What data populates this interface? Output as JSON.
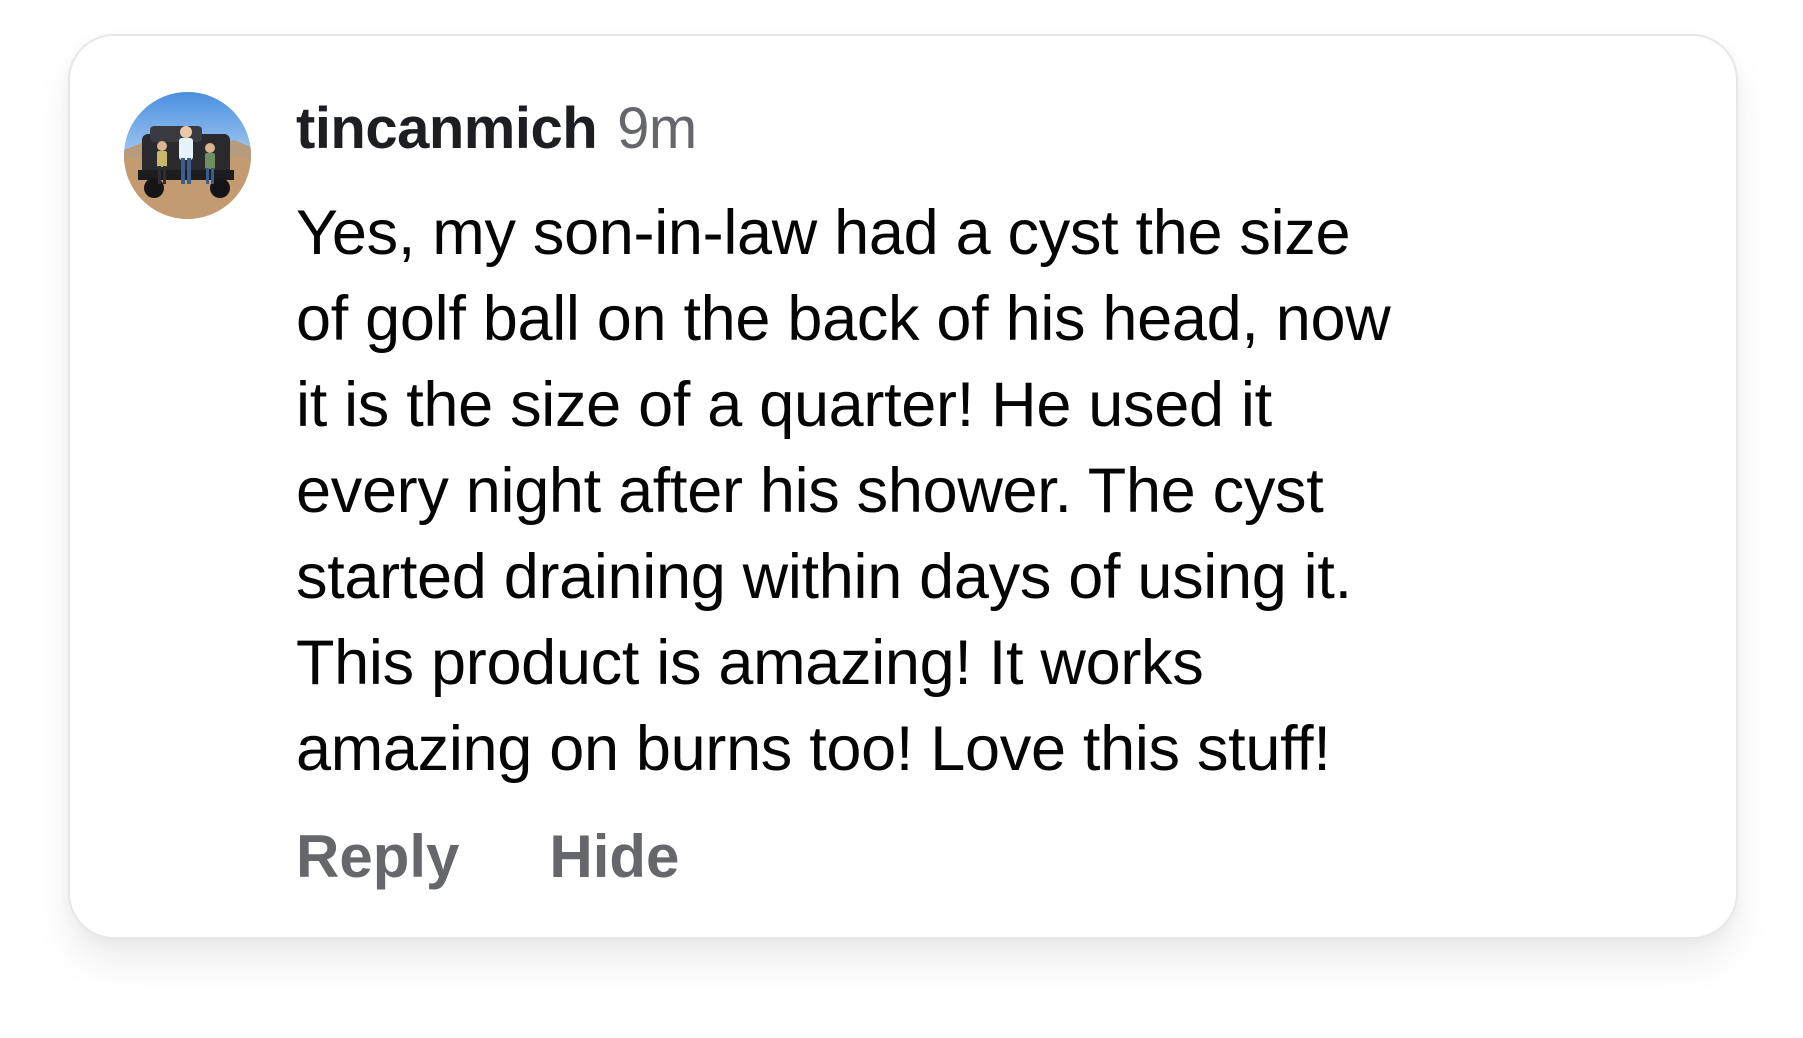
{
  "comment": {
    "author": {
      "username": "tincanmich",
      "avatar_icon": "profile-photo-avatar"
    },
    "timestamp": "9m",
    "body_lines": [
      "Yes, my son-in-law had a cyst the size",
      "of golf ball on the back of his head, now",
      "it is the size of a quarter! He used it",
      "every night after his shower. The cyst",
      "started draining within days of using it.",
      "This product is amazing! It works",
      "amazing on burns too! Love this stuff!"
    ],
    "actions": {
      "reply_label": "Reply",
      "hide_label": "Hide"
    }
  },
  "colors": {
    "username": "#1c1e21",
    "secondary_text": "#65676b",
    "body_text": "#050505",
    "card_border": "#e6e7ea"
  }
}
